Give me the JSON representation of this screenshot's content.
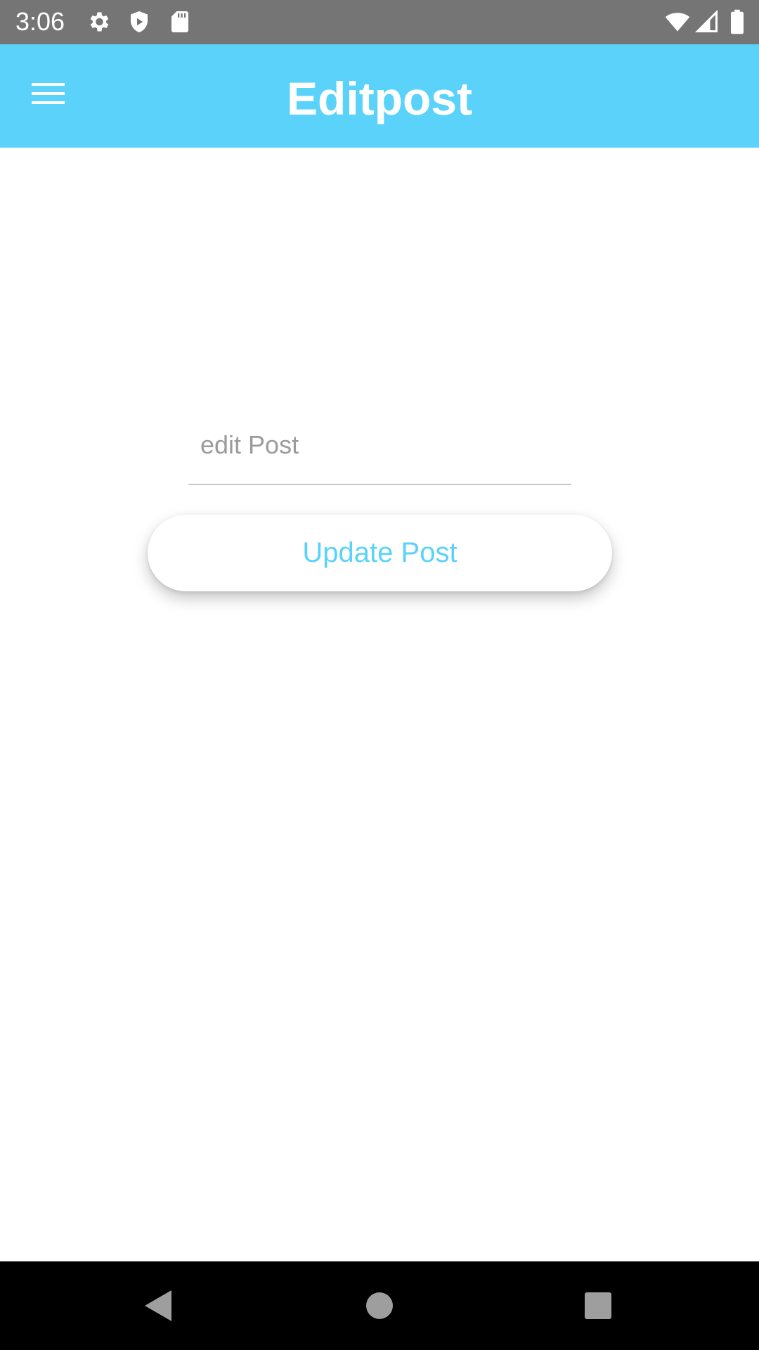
{
  "status_bar": {
    "time": "3:06",
    "icons_left": [
      "settings-icon",
      "shield-icon",
      "sd-card-icon"
    ],
    "icons_right": [
      "wifi-icon",
      "cell-signal-icon",
      "battery-icon"
    ]
  },
  "app_bar": {
    "title": "Editpost",
    "menu_icon": "hamburger-menu-icon",
    "background_color": "#5ad2fa"
  },
  "form": {
    "edit_placeholder": "edit Post",
    "edit_value": "",
    "update_label": "Update Post",
    "accent_color": "#5ad2fa"
  },
  "nav_bar": {
    "buttons": [
      "back-icon",
      "home-icon",
      "recents-icon"
    ]
  }
}
